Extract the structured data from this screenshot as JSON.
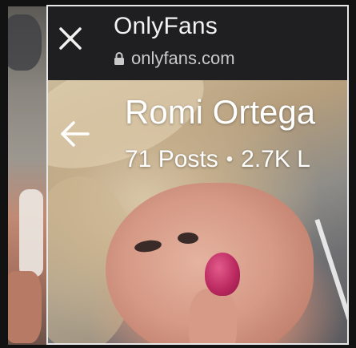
{
  "browser": {
    "title": "OnlyFans",
    "url": "onlyfans.com",
    "close_icon": "close-icon",
    "lock_icon": "lock-icon"
  },
  "profile": {
    "name": "Romi Ortega",
    "posts": "71 Posts",
    "separator": "•",
    "likes": "2.7K L",
    "back_icon": "arrow-left-icon"
  },
  "colors": {
    "chrome_bg": "#1f1f21",
    "text_primary": "#f2f2f2",
    "text_secondary": "#c9c9c9"
  }
}
